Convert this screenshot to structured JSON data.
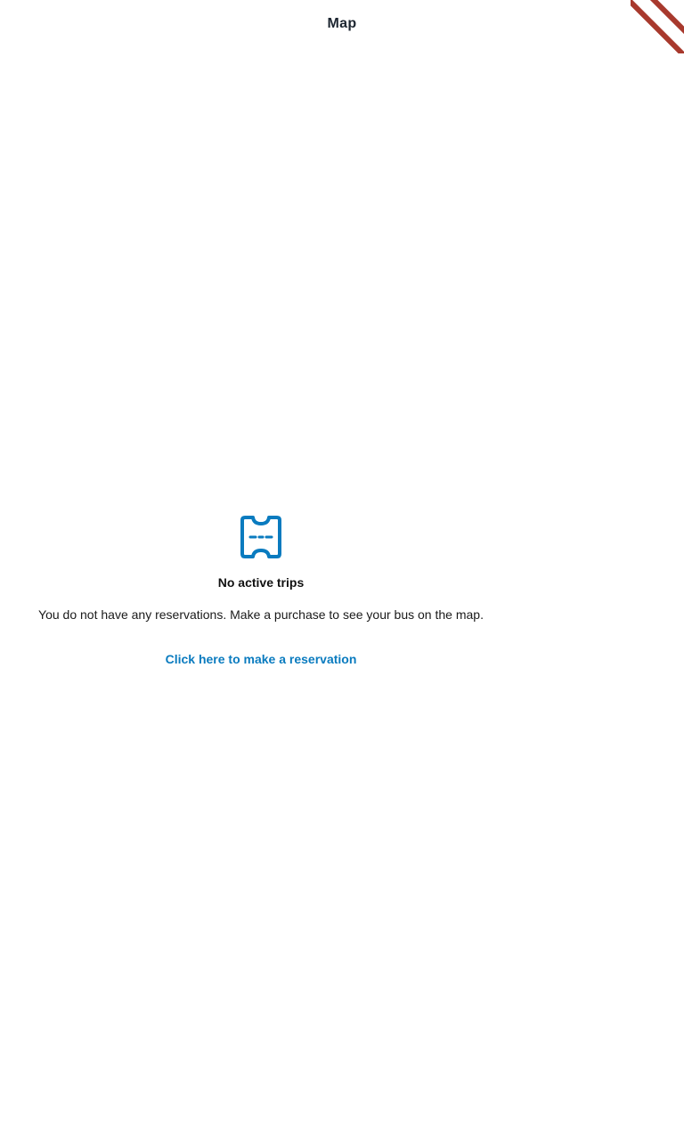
{
  "header": {
    "title": "Map"
  },
  "empty_state": {
    "icon": "ticket-icon",
    "title": "No active trips",
    "message": "You do not have any reservations. Make a purchase to see your bus on the map.",
    "link_label": "Click here to make a reservation"
  },
  "colors": {
    "accent": "#0a7bbf",
    "debug_banner": "#a8392d"
  }
}
